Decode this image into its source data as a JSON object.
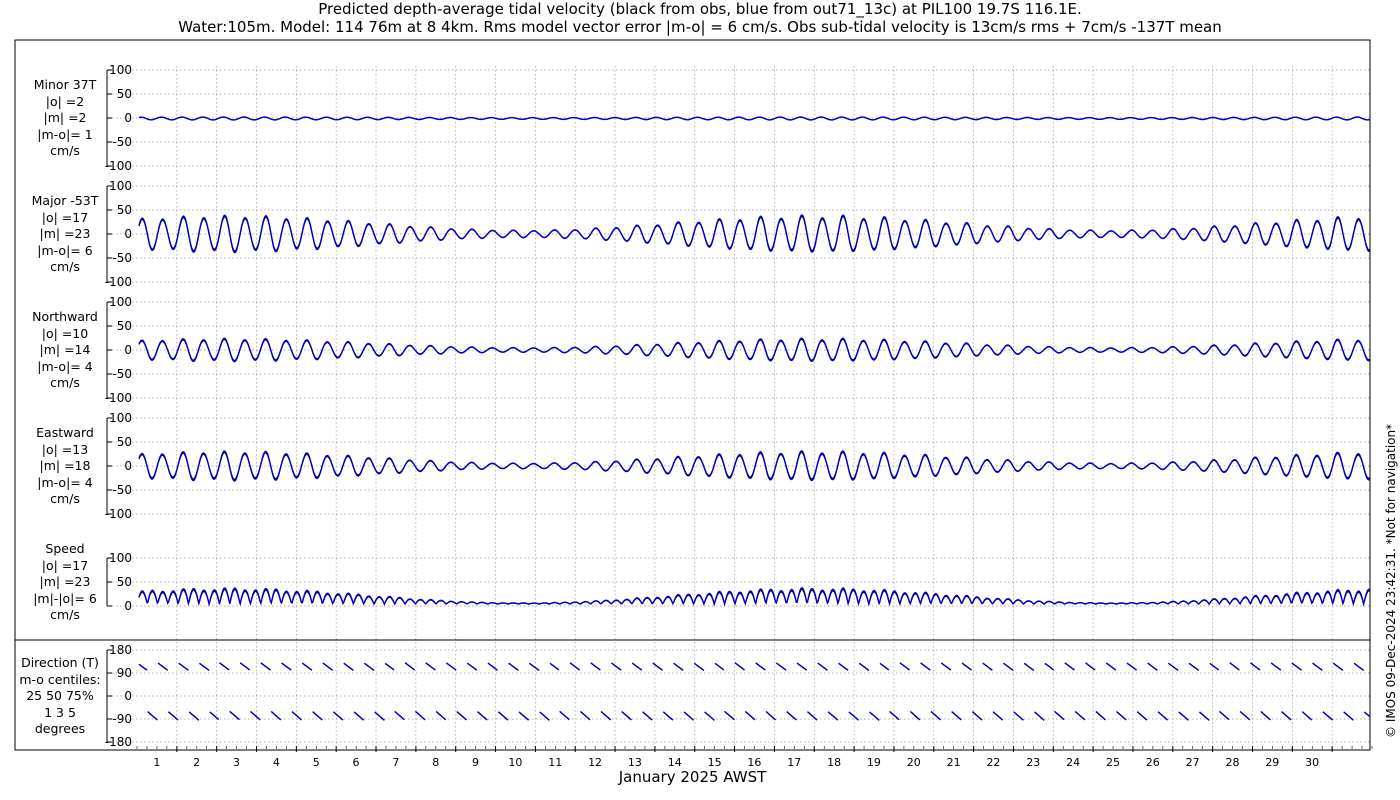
{
  "title": {
    "line1": "Predicted depth-average tidal velocity (black from obs, blue from out71_13c) at PIL100 19.7S 116.1E.",
    "line2": "Water:105m. Model: 114 76m at 8 4km. Rms model vector error |m-o| = 6 cm/s. Obs sub-tidal velocity is 13cm/s rms + 7cm/s -137T mean"
  },
  "xlabel": "January 2025 AWST",
  "copyright": "© IMOS 09-Dec-2024 23:42:31. *Not for navigation*",
  "panels": [
    {
      "key": "minor",
      "label": [
        "Minor 37T",
        "|o| =2",
        "|m| =2",
        "|m-o|= 1",
        "cm/s"
      ]
    },
    {
      "key": "major",
      "label": [
        "Major -53T",
        "|o| =17",
        "|m| =23",
        "|m-o|= 6",
        "cm/s"
      ]
    },
    {
      "key": "north",
      "label": [
        "Northward",
        "|o| =10",
        "|m| =14",
        "|m-o|= 4",
        "cm/s"
      ]
    },
    {
      "key": "east",
      "label": [
        "Eastward",
        "|o| =13",
        "|m| =18",
        "|m-o|= 4",
        "cm/s"
      ]
    },
    {
      "key": "speed",
      "label": [
        "Speed",
        "|o| =17",
        "|m| =23",
        "|m|-|o|= 6",
        "cm/s"
      ]
    },
    {
      "key": "direction",
      "label": [
        "Direction (T)",
        "m-o centiles:",
        "25  50  75%",
        "1   3   5",
        "degrees"
      ]
    }
  ],
  "chart_data": [
    {
      "type": "line",
      "name": "Minor 37T",
      "ylim": [
        -100,
        100
      ],
      "yticks": [
        100,
        50,
        0,
        -50,
        -100
      ],
      "xlim": [
        0,
        31
      ],
      "series_approx": {
        "shape": "semidiurnal",
        "amplitude": 3,
        "period_days": 0.5175,
        "spring_neap_days": 14.77
      }
    },
    {
      "type": "line",
      "name": "Major -53T",
      "ylim": [
        -100,
        100
      ],
      "yticks": [
        100,
        50,
        0,
        -50,
        -100
      ],
      "xlim": [
        0,
        31
      ],
      "series_approx": {
        "shape": "semidiurnal",
        "amplitude_range": [
          8,
          40
        ],
        "period_days": 0.5175,
        "spring_neap_days": 14.77
      }
    },
    {
      "type": "line",
      "name": "Northward",
      "ylim": [
        -100,
        100
      ],
      "yticks": [
        100,
        50,
        0,
        -50,
        -100
      ],
      "xlim": [
        0,
        31
      ],
      "series_approx": {
        "shape": "semidiurnal",
        "amplitude_range": [
          5,
          25
        ],
        "period_days": 0.5175,
        "spring_neap_days": 14.77
      }
    },
    {
      "type": "line",
      "name": "Eastward",
      "ylim": [
        -100,
        100
      ],
      "yticks": [
        100,
        50,
        0,
        -50,
        -100
      ],
      "xlim": [
        0,
        31
      ],
      "series_approx": {
        "shape": "semidiurnal",
        "amplitude_range": [
          5,
          33
        ],
        "period_days": 0.5175,
        "spring_neap_days": 14.77
      }
    },
    {
      "type": "line",
      "name": "Speed",
      "ylim": [
        0,
        100
      ],
      "yticks": [
        100,
        50,
        0
      ],
      "xlim": [
        0,
        31
      ],
      "series_approx": {
        "shape": "rectified",
        "amplitude_range": [
          3,
          45
        ]
      }
    },
    {
      "type": "line",
      "name": "Direction (T)",
      "ylim": [
        -180,
        180
      ],
      "yticks": [
        180,
        90,
        0,
        -90,
        -180
      ],
      "xlim": [
        0,
        31
      ],
      "series_approx": {
        "shape": "sawtooth",
        "period_days": 0.5175
      }
    }
  ],
  "x_ticks": [
    "1",
    "2",
    "3",
    "4",
    "5",
    "6",
    "7",
    "8",
    "9",
    "10",
    "11",
    "12",
    "13",
    "14",
    "15",
    "16",
    "17",
    "18",
    "19",
    "20",
    "21",
    "22",
    "23",
    "24",
    "25",
    "26",
    "27",
    "28",
    "29",
    "30"
  ],
  "colors": {
    "obs": "#000000",
    "model": "#0000cc",
    "grid": "#999999"
  }
}
